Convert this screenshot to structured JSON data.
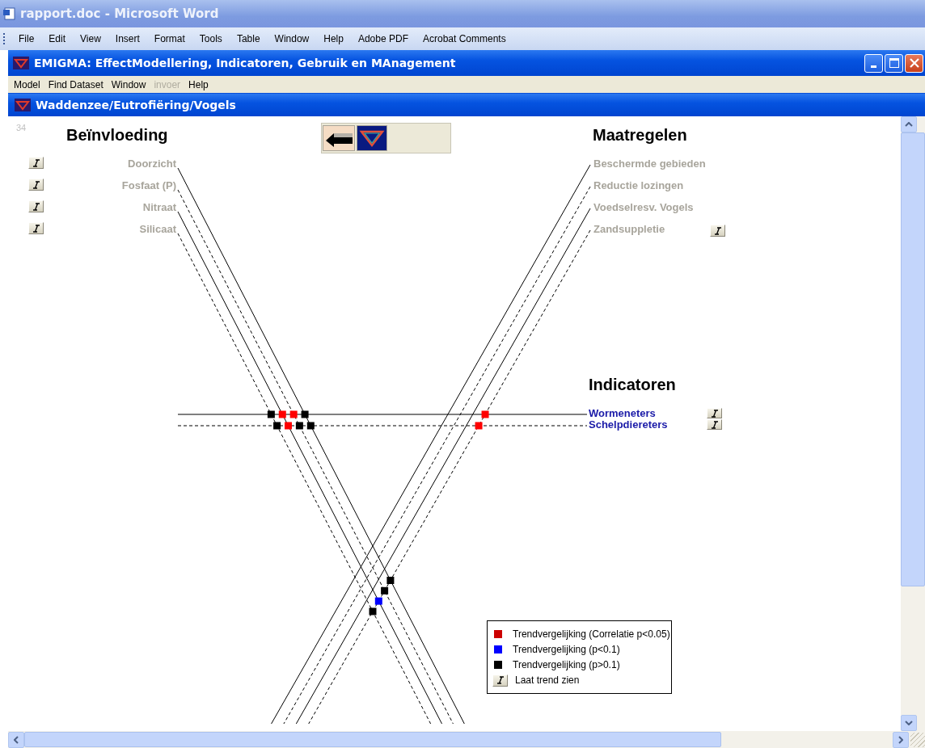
{
  "word_window": {
    "title": "rapport.doc - Microsoft Word",
    "menu": [
      "File",
      "Edit",
      "View",
      "Insert",
      "Format",
      "Tools",
      "Table",
      "Window",
      "Help",
      "Adobe PDF",
      "Acrobat Comments"
    ]
  },
  "app_window": {
    "title": "EMIGMA: EffectModellering, Indicatoren, Gebruik en MAnagement",
    "menu": [
      {
        "label": "Model",
        "disabled": false
      },
      {
        "label": "Find Dataset",
        "disabled": false
      },
      {
        "label": "Window",
        "disabled": false
      },
      {
        "label": "invoer",
        "disabled": true
      },
      {
        "label": "Help",
        "disabled": false
      }
    ]
  },
  "child_window": {
    "title": "Waddenzee/Eutrofiëring/Vogels",
    "page_number": "34"
  },
  "diagram": {
    "pressures": {
      "heading": "Beïnvloeding",
      "items": [
        {
          "label": "Doorzicht",
          "kind": "solid",
          "active": false,
          "trend_button": true
        },
        {
          "label": "Fosfaat (P)",
          "kind": "dashed",
          "active": false,
          "trend_button": true
        },
        {
          "label": "Nitraat",
          "kind": "solid",
          "active": false,
          "trend_button": true
        },
        {
          "label": "Silicaat",
          "kind": "dashed",
          "active": false,
          "trend_button": true
        }
      ]
    },
    "measures": {
      "heading": "Maatregelen",
      "items": [
        {
          "label": "Beschermde gebieden",
          "kind": "solid",
          "active": false,
          "trend_button": false
        },
        {
          "label": "Reductie lozingen",
          "kind": "dashed",
          "active": false,
          "trend_button": false
        },
        {
          "label": "Voedselresv. Vogels",
          "kind": "solid",
          "active": false,
          "trend_button": false
        },
        {
          "label": "Zandsuppletie",
          "kind": "dashed",
          "active": false,
          "trend_button": true,
          "pressure_marks": [
            {
              "color": "#000000"
            },
            {
              "color": "#000000"
            },
            {
              "color": "#0000ff"
            },
            {
              "color": "#000000"
            }
          ],
          "indicator_marks": [
            {
              "color": "#ff0000"
            },
            {
              "color": "#ff0000"
            }
          ]
        }
      ]
    },
    "indicators": {
      "heading": "Indicatoren",
      "items": [
        {
          "label": "Wormeneters",
          "kind": "solid",
          "active": true,
          "trend_button": true,
          "pressure_marks": [
            {
              "color": "#000000"
            },
            {
              "color": "#ff0000"
            },
            {
              "color": "#ff0000"
            },
            {
              "color": "#000000"
            }
          ]
        },
        {
          "label": "Schelpdiereters",
          "kind": "dashed",
          "active": true,
          "trend_button": true,
          "pressure_marks": [
            {
              "color": "#000000"
            },
            {
              "color": "#000000"
            },
            {
              "color": "#ff0000"
            },
            {
              "color": "#000000"
            }
          ]
        }
      ]
    }
  },
  "legend": [
    {
      "kind": "swatch",
      "color": "#cc0000",
      "text": "Trendvergelijking (Correlatie p<0.05)"
    },
    {
      "kind": "swatch",
      "color": "#0000ff",
      "text": "Trendvergelijking (p<0.1)"
    },
    {
      "kind": "swatch",
      "color": "#000000",
      "text": "Trendvergelijking (p>0.1)"
    },
    {
      "kind": "trend",
      "text": "Laat trend zien"
    }
  ]
}
